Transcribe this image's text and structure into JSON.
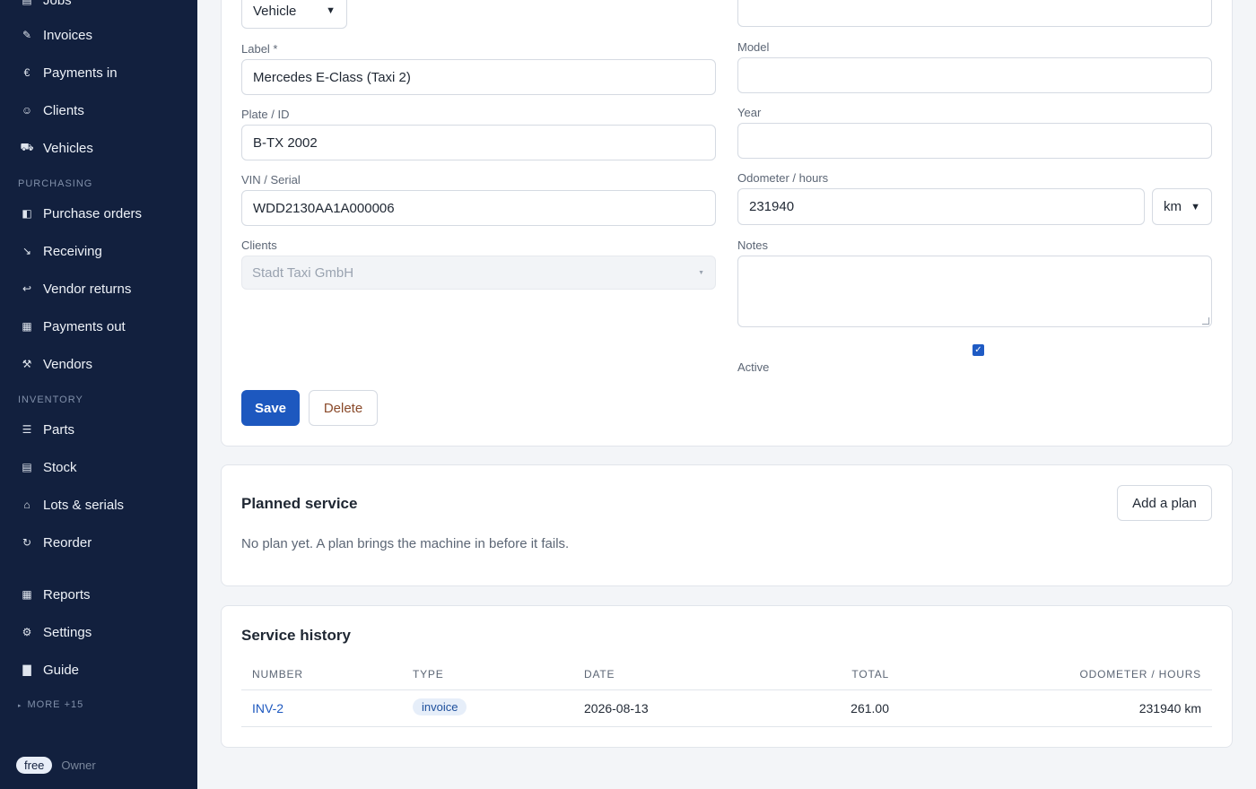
{
  "sidebar": {
    "top_item": "Jobs",
    "items_top": [
      {
        "label": "Invoices",
        "icon": "pencil-icon"
      },
      {
        "label": "Payments in",
        "icon": "euro-icon"
      },
      {
        "label": "Clients",
        "icon": "smiley-icon"
      },
      {
        "label": "Vehicles",
        "icon": "car-icon"
      }
    ],
    "section_purchasing": "PURCHASING",
    "items_purchasing": [
      {
        "label": "Purchase orders",
        "icon": "half-square-icon"
      },
      {
        "label": "Receiving",
        "icon": "arrow-icon"
      },
      {
        "label": "Vendor returns",
        "icon": "return-icon"
      },
      {
        "label": "Payments out",
        "icon": "receipt-icon"
      },
      {
        "label": "Vendors",
        "icon": "tools-icon"
      }
    ],
    "section_inventory": "INVENTORY",
    "items_inventory": [
      {
        "label": "Parts",
        "icon": "list-icon"
      },
      {
        "label": "Stock",
        "icon": "box-icon"
      },
      {
        "label": "Lots & serials",
        "icon": "tag-icon"
      },
      {
        "label": "Reorder",
        "icon": "refresh-icon"
      }
    ],
    "items_bottom": [
      {
        "label": "Reports",
        "icon": "grid-icon"
      },
      {
        "label": "Settings",
        "icon": "gear-icon"
      },
      {
        "label": "Guide",
        "icon": "book-icon"
      }
    ],
    "more": "MORE +15",
    "plan": "free",
    "role": "Owner"
  },
  "form": {
    "type_select": "Vehicle",
    "label_label": "Label *",
    "label_value": "Mercedes E-Class (Taxi 2)",
    "plate_label": "Plate / ID",
    "plate_value": "B-TX 2002",
    "vin_label": "VIN / Serial",
    "vin_value": "WDD2130AA1A000006",
    "clients_label": "Clients",
    "clients_value": "Stadt Taxi GmbH",
    "model_label": "Model",
    "model_value": "",
    "year_label": "Year",
    "year_value": "",
    "odometer_label": "Odometer / hours",
    "odometer_value": "231940",
    "odometer_unit": "km",
    "notes_label": "Notes",
    "active_label": "Active",
    "save": "Save",
    "delete": "Delete"
  },
  "planned": {
    "title": "Planned service",
    "empty_text": "No plan yet. A plan brings the machine in before it fails.",
    "add_button": "Add a plan"
  },
  "history": {
    "title": "Service history",
    "columns": [
      "NUMBER",
      "TYPE",
      "DATE",
      "TOTAL",
      "ODOMETER / HOURS"
    ],
    "rows": [
      {
        "number": "INV-2",
        "type": "invoice",
        "date": "2026-08-13",
        "total": "261.00",
        "odometer": "231940 km"
      }
    ]
  }
}
